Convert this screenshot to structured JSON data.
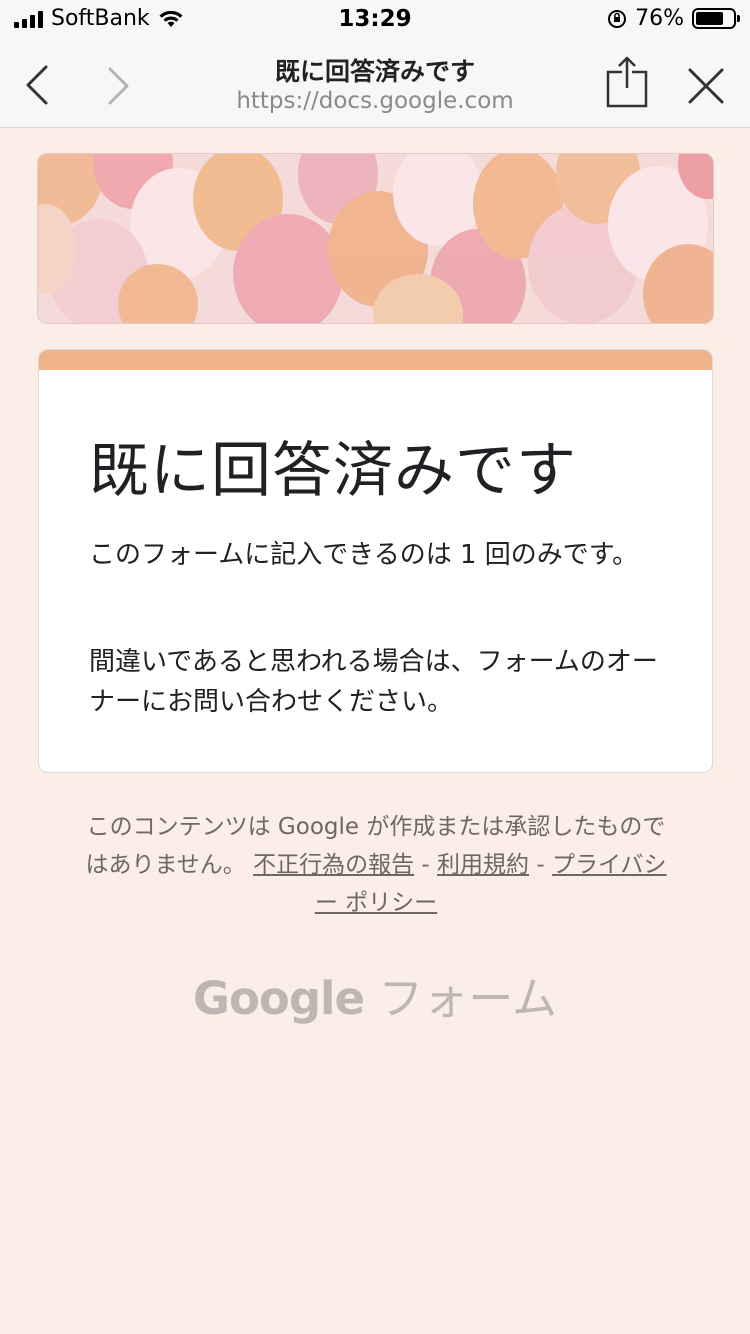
{
  "status_bar": {
    "carrier": "SoftBank",
    "time": "13:29",
    "battery_text": "76%",
    "battery_level": 0.76
  },
  "nav": {
    "title": "既に回答済みです",
    "url": "https://docs.google.com",
    "back_icon": "chevron-left-icon",
    "forward_icon": "chevron-right-icon",
    "share_icon": "share-icon",
    "close_icon": "close-icon"
  },
  "card": {
    "accent_color": "#eeb386",
    "title": "既に回答済みです",
    "message1": "このフォームに記入できるのは 1 回のみです。",
    "message2": "間違いであると思われる場合は、フォームのオーナーにお問い合わせください。"
  },
  "footer": {
    "disclaimer": "このコンテンツは Google が作成または承認したものではありません。",
    "report_link": "不正行為の報告",
    "separator": "-",
    "terms_link": "利用規約",
    "privacy_link": "プライバシー ポリシー"
  },
  "brand": {
    "google": "Google",
    "product": "フォーム"
  }
}
